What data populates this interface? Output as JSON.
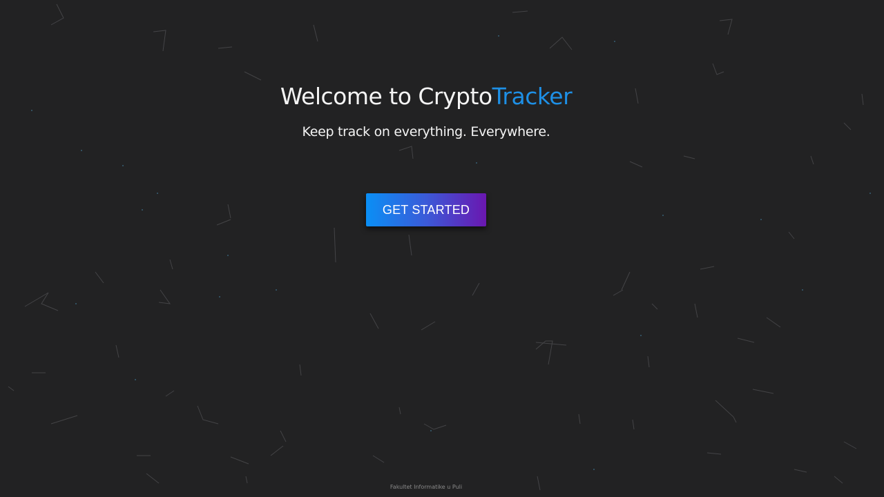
{
  "hero": {
    "title_prefix": "Welcome to Crypto",
    "title_accent": "Tracker",
    "subtitle": "Keep track on everything. Everywhere."
  },
  "cta": {
    "label": "GET STARTED"
  },
  "footer": {
    "text": "Fakultet Informatike u Puli"
  },
  "colors": {
    "background": "#222223",
    "accent": "#1e90e6",
    "button_gradient_start": "#0a8ff5",
    "button_gradient_end": "#6a17b0"
  }
}
